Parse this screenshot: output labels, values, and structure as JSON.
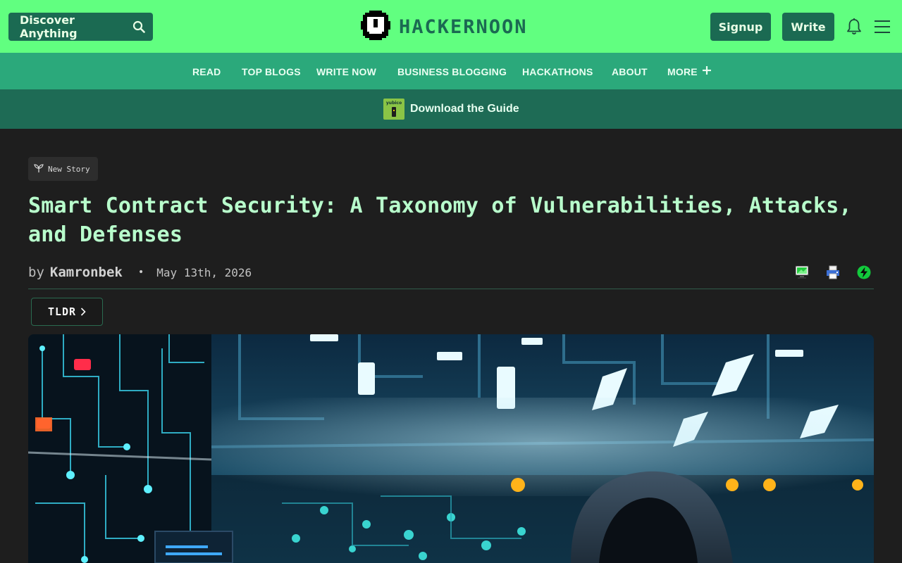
{
  "header": {
    "discover_label": "Discover Anything",
    "logo_text": "HACKERNOON",
    "signup_label": "Signup",
    "write_label": "Write",
    "brand_green": "#61ff80",
    "brand_dark": "#1b6a52"
  },
  "nav": {
    "items": [
      {
        "label": "READ"
      },
      {
        "label": "TOP BLOGS"
      },
      {
        "label": "WRITE NOW"
      },
      {
        "label": "BUSINESS BLOGGING"
      },
      {
        "label": "HACKATHONS"
      },
      {
        "label": "ABOUT"
      }
    ],
    "more_label": "MORE",
    "background": "#2ba97b"
  },
  "promo": {
    "logo_text": "yubico",
    "text": "Download the Guide"
  },
  "article": {
    "badge": "New Story",
    "title": "Smart Contract Security: A Taxonomy of Vulnerabilities, Attacks, and Defenses",
    "by": "by",
    "author": "Kamronbek",
    "separator": "•",
    "date": "May 13th, 2026",
    "tldr_label": "TLDR",
    "title_color": "#b8ffcc"
  },
  "icons": {
    "search": "search-icon",
    "bell": "bell-icon",
    "menu": "hamburger-menu-icon",
    "plus": "plus-icon",
    "sprout": "sprout-icon",
    "screen": "computer-screen-icon",
    "print": "printer-icon",
    "boost": "lightning-boost-icon",
    "chevron": "chevron-right-icon"
  }
}
